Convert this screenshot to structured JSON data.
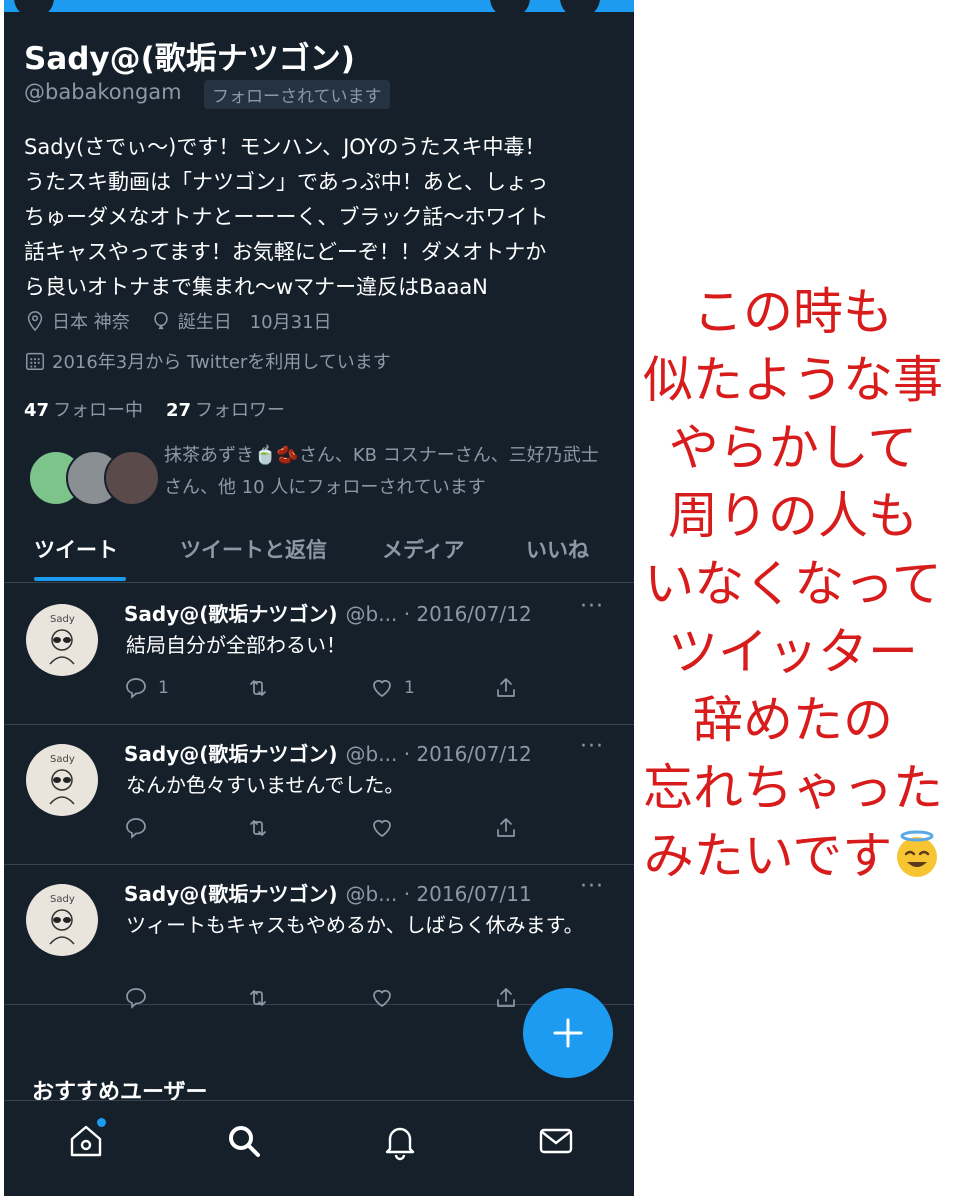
{
  "profile": {
    "name": "Sady@(歌垢ナツゴン)",
    "handle": "@babakongam",
    "follows_you": "フォローされています",
    "bio": "Sady(さでぃ〜)です！モンハン、JOYのうたスキ中毒！\nうたスキ動画は「ナツゴン」であっぷ中！あと、しょっ\nちゅーダメなオトナとーーーく、ブラック話〜ホワイト\n話キャスやってます！お気軽にどーぞ！！ダメオトナか\nら良いオトナまで集まれ〜wマナー違反はBaaaN",
    "location": "日本 神奈",
    "birthday": "誕生日　10月31日",
    "joined": "2016年3月から Twitterを利用しています",
    "following_count": "47",
    "following_label": "フォロー中",
    "followers_count": "27",
    "followers_label": "フォロワー",
    "followed_by": "抹茶あずき🍵🫘さん、KB コスナーさん、三好乃武士さん、他 10 人にフォローされています"
  },
  "tabs": [
    {
      "label": "ツイート",
      "active": true
    },
    {
      "label": "ツイートと返信",
      "active": false
    },
    {
      "label": "メディア",
      "active": false
    },
    {
      "label": "いいね",
      "active": false
    }
  ],
  "tweets": [
    {
      "name": "Sady@(歌垢ナツゴン)",
      "handle": "@b...",
      "date": "· 2016/07/12",
      "text": "結局自分が全部わるい！",
      "replies": "1",
      "likes": "1"
    },
    {
      "name": "Sady@(歌垢ナツゴン)",
      "handle": "@b...",
      "date": "· 2016/07/12",
      "text": "なんか色々すいませんでした。",
      "replies": "",
      "likes": ""
    },
    {
      "name": "Sady@(歌垢ナツゴン)",
      "handle": "@b...",
      "date": "· 2016/07/11",
      "text": "ツィートもキャスもやめるか、しばらく休みます。",
      "replies": "",
      "likes": ""
    }
  ],
  "avatar_text": "Sady",
  "more_label": "···",
  "recommended_title": "おすすめユーザー",
  "caption": "この時も\n似たような事\nやらかして\n周りの人も\nいなくなって\nツイッター\n辞めたの\n忘れちゃった\nみたいです",
  "colors": {
    "background": "#15202b",
    "accent": "#1d9bf0",
    "muted": "#8b98a5",
    "caption": "#d81c1c"
  },
  "icons": [
    "location-icon",
    "balloon-icon",
    "calendar-icon",
    "reply-icon",
    "retweet-icon",
    "like-icon",
    "share-icon",
    "compose-icon",
    "home-icon",
    "search-icon",
    "notifications-icon",
    "messages-icon",
    "halo-emoji-icon"
  ]
}
